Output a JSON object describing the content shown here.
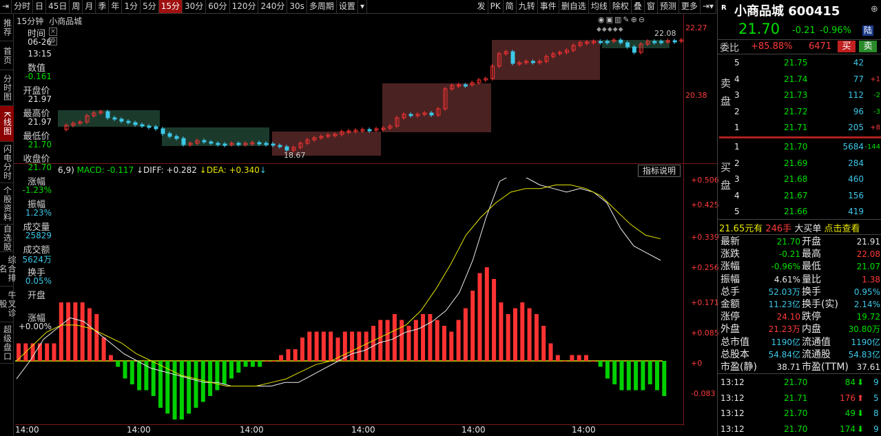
{
  "toolbar": {
    "items": [
      "分时",
      "日",
      "45日",
      "周",
      "月",
      "季",
      "年",
      "1分",
      "5分",
      "15分",
      "30分",
      "60分",
      "120分",
      "240分",
      "30s",
      "多周期",
      "设置"
    ],
    "active": "15分",
    "right_items": [
      "发",
      "PK",
      "简",
      "九转",
      "事件",
      "删自选",
      "均线",
      "除权",
      "叠",
      "窗",
      "预测",
      "更多"
    ]
  },
  "leftnav": [
    "推荐",
    "首页",
    "分时图",
    "K线图",
    "闪电分时",
    "个股资料",
    "自选股",
    "综合排名",
    "牛叉诊股",
    "超级盘口"
  ],
  "chart_header": {
    "period": "15分钟",
    "name": "小商品城"
  },
  "info_panel": {
    "items": [
      {
        "label": "时间",
        "value": "06-26"
      },
      {
        "label": "",
        "value": "13:15"
      },
      {
        "label": "数值",
        "value": "-0.161"
      },
      {
        "label": "开盘价",
        "value": "21.97"
      },
      {
        "label": "最高价",
        "value": "21.97"
      },
      {
        "label": "最低价",
        "value": "21.70"
      },
      {
        "label": "收盘价",
        "value": "21.70"
      },
      {
        "label": "涨幅",
        "value": "-1.23%"
      },
      {
        "label": "振幅",
        "value": "1.23%"
      },
      {
        "label": "成交量",
        "value": "25829"
      },
      {
        "label": "成交额",
        "value": "5624万"
      },
      {
        "label": "换手",
        "value": "0.05%"
      },
      {
        "label": "开盘",
        "value": ""
      },
      {
        "label": "涨幅",
        "value": "+0.00%"
      }
    ]
  },
  "kline": {
    "price_high_label": "22.27",
    "price_mid_label": "20.38",
    "max_marker": "22.08",
    "min_marker": "18.67"
  },
  "macd_header": {
    "params": "6,9)",
    "macd": "MACD: -0.117",
    "diff": "DIFF: +0.282",
    "dea": "DEA: +0.340",
    "help": "指标说明"
  },
  "macd_axis": [
    "+0.506",
    "+0.425",
    "+0.339",
    "+0.256",
    "+0.171",
    "+0.085",
    "+0",
    "-0.083"
  ],
  "time_axis": [
    "14:00",
    "14:00",
    "14:00",
    "14:00",
    "14:00",
    "14:00"
  ],
  "chart_data": {
    "type": "bar",
    "title": "",
    "series": [
      {
        "name": "MACD",
        "values": [
          0.03,
          0.03,
          0.03,
          0.03,
          0.03,
          0.03,
          0.1,
          0.1,
          0.1,
          0.1,
          0.09,
          0.08,
          0.04,
          0.01,
          -0.01,
          -0.03,
          -0.04,
          -0.05,
          -0.05,
          -0.06,
          -0.08,
          -0.09,
          -0.1,
          -0.1,
          -0.09,
          -0.08,
          -0.07,
          -0.06,
          -0.05,
          -0.04,
          -0.03,
          -0.02,
          -0.01,
          -0.01,
          -0.01,
          0.0,
          0.0,
          0.01,
          0.02,
          0.02,
          0.04,
          0.05,
          0.05,
          0.05,
          0.05,
          0.04,
          0.05,
          0.05,
          0.05,
          0.05,
          0.06,
          0.07,
          0.07,
          0.08,
          0.07,
          0.06,
          0.07,
          0.08,
          0.08,
          0.07,
          0.06,
          0.05,
          0.07,
          0.09,
          0.12,
          0.15,
          0.16,
          0.14,
          0.1,
          0.08,
          0.09,
          0.1,
          0.09,
          0.08,
          0.06,
          0.03,
          0.01,
          0.0,
          0.01,
          0.01,
          0.01,
          0.0,
          -0.01,
          -0.03,
          -0.04,
          -0.05,
          -0.05,
          -0.05,
          -0.05,
          -0.04,
          -0.05,
          -0.06
        ]
      },
      {
        "name": "DIFF",
        "values": [
          -0.05,
          0.0,
          0.06,
          0.09,
          0.12,
          0.11,
          0.08,
          0.05,
          0.02,
          0.0,
          -0.02,
          -0.03,
          -0.04,
          -0.05,
          -0.06,
          -0.06,
          -0.07,
          -0.07,
          -0.07,
          -0.07,
          -0.06,
          -0.06,
          -0.04,
          -0.02,
          0.0,
          0.02,
          0.03,
          0.05,
          0.06,
          0.08,
          0.09,
          0.11,
          0.14,
          0.19,
          0.28,
          0.4,
          0.5,
          0.52,
          0.51,
          0.49,
          0.48,
          0.47,
          0.48,
          0.47,
          0.44,
          0.37,
          0.32,
          0.3,
          0.28
        ]
      },
      {
        "name": "DEA",
        "values": [
          0.0,
          0.04,
          0.08,
          0.1,
          0.1,
          0.09,
          0.07,
          0.05,
          0.02,
          0.0,
          -0.02,
          -0.04,
          -0.05,
          -0.06,
          -0.07,
          -0.07,
          -0.07,
          -0.06,
          -0.05,
          -0.03,
          -0.01,
          0.0,
          0.02,
          0.04,
          0.06,
          0.08,
          0.1,
          0.14,
          0.2,
          0.27,
          0.35,
          0.4,
          0.44,
          0.47,
          0.48,
          0.48,
          0.49,
          0.49,
          0.48,
          0.46,
          0.42,
          0.38,
          0.35,
          0.34
        ]
      }
    ]
  },
  "right": {
    "logo": "R",
    "title": "小商品城",
    "code": "600415",
    "price": "21.70",
    "change": "-0.21",
    "pct": "-0.96%",
    "tag": "陆",
    "weibi_label": "委比",
    "weibi": "+85.88%",
    "weicha": "6471",
    "buy_btn": "买",
    "sell_btn": "卖",
    "sell_side_label": "卖盘",
    "buy_side_label": "买盘",
    "asks": [
      {
        "lvl": "5",
        "price": "21.75",
        "vol": "42",
        "chg": ""
      },
      {
        "lvl": "4",
        "price": "21.74",
        "vol": "77",
        "chg": "+1"
      },
      {
        "lvl": "3",
        "price": "21.73",
        "vol": "112",
        "chg": "-2"
      },
      {
        "lvl": "2",
        "price": "21.72",
        "vol": "96",
        "chg": "-3"
      },
      {
        "lvl": "1",
        "price": "21.71",
        "vol": "205",
        "chg": "+8"
      }
    ],
    "bids": [
      {
        "lvl": "1",
        "price": "21.70",
        "vol": "5684",
        "chg": "-144"
      },
      {
        "lvl": "2",
        "price": "21.69",
        "vol": "284",
        "chg": ""
      },
      {
        "lvl": "3",
        "price": "21.68",
        "vol": "460",
        "chg": ""
      },
      {
        "lvl": "4",
        "price": "21.67",
        "vol": "156",
        "chg": ""
      },
      {
        "lvl": "5",
        "price": "21.66",
        "vol": "419",
        "chg": ""
      }
    ],
    "bigbuy": {
      "price": "21.65元有",
      "qty": "246手",
      "label": "大买单",
      "link": "点击查看"
    },
    "stats": [
      [
        "最新",
        "21.70",
        "开盘",
        "21.91"
      ],
      [
        "涨跌",
        "-0.21",
        "最高",
        "22.08"
      ],
      [
        "涨幅",
        "-0.96%",
        "最低",
        "21.07"
      ],
      [
        "振幅",
        "4.61%",
        "量比",
        "1.38"
      ],
      [
        "总手",
        "52.03万",
        "换手",
        "0.95%"
      ],
      [
        "金额",
        "11.23亿",
        "换手(实)",
        "2.14%"
      ],
      [
        "涨停",
        "24.10",
        "跌停",
        "19.72"
      ],
      [
        "外盘",
        "21.23万",
        "内盘",
        "30.80万"
      ],
      [
        "总市值",
        "1190亿",
        "流通值",
        "1190亿"
      ],
      [
        "总股本",
        "54.84亿",
        "流通股",
        "54.83亿"
      ],
      [
        "市盈(静)",
        "38.71",
        "市盈(TTM)",
        "37.61"
      ]
    ],
    "ticks": [
      {
        "time": "13:12",
        "price": "21.70",
        "vol": "84",
        "dir": "down",
        "n": "9"
      },
      {
        "time": "13:12",
        "price": "21.71",
        "vol": "176",
        "dir": "up",
        "n": "5"
      },
      {
        "time": "13:12",
        "price": "21.70",
        "vol": "49",
        "dir": "down",
        "n": "8"
      },
      {
        "time": "13:12",
        "price": "21.70",
        "vol": "174",
        "dir": "down",
        "n": "9"
      }
    ]
  },
  "colors": {
    "up": "#ff3232",
    "down": "#00d000",
    "cyan": "#3cc8e8",
    "yellow": "#e8e800",
    "box_red": "#4a2222",
    "box_green": "#1c3a2c"
  }
}
